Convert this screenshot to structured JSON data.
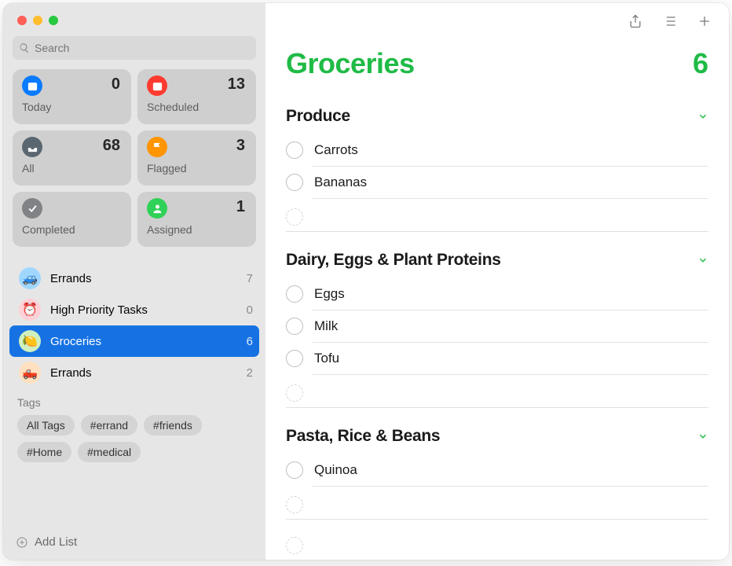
{
  "search": {
    "placeholder": "Search"
  },
  "smart_lists": {
    "today": {
      "label": "Today",
      "count": "0"
    },
    "scheduled": {
      "label": "Scheduled",
      "count": "13"
    },
    "all": {
      "label": "All",
      "count": "68"
    },
    "flagged": {
      "label": "Flagged",
      "count": "3"
    },
    "completed": {
      "label": "Completed",
      "count": ""
    },
    "assigned": {
      "label": "Assigned",
      "count": "1"
    }
  },
  "lists": [
    {
      "name": "Errands",
      "count": "7",
      "emoji": "🚙"
    },
    {
      "name": "High Priority Tasks",
      "count": "0",
      "emoji": "⏰"
    },
    {
      "name": "Groceries",
      "count": "6",
      "emoji": "🍋"
    },
    {
      "name": "Errands",
      "count": "2",
      "emoji": "🛻"
    }
  ],
  "tags": {
    "header": "Tags",
    "items": [
      "All Tags",
      "#errand",
      "#friends",
      "#Home",
      "#medical"
    ]
  },
  "add_list_label": "Add List",
  "current_list": {
    "title": "Groceries",
    "count": "6"
  },
  "sections": [
    {
      "title": "Produce",
      "items": [
        "Carrots",
        "Bananas"
      ]
    },
    {
      "title": "Dairy, Eggs & Plant Proteins",
      "items": [
        "Eggs",
        "Milk",
        "Tofu"
      ]
    },
    {
      "title": "Pasta, Rice & Beans",
      "items": [
        "Quinoa"
      ]
    }
  ]
}
